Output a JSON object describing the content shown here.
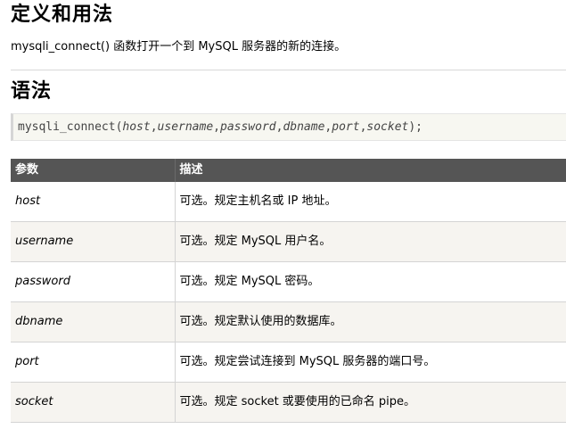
{
  "definition": {
    "heading": "定义和用法",
    "text": "mysqli_connect() 函数打开一个到 MySQL 服务器的新的连接。"
  },
  "syntax": {
    "heading": "语法",
    "code": {
      "func": "mysqli_connect(",
      "p1": "host",
      "p2": "username",
      "p3": "password",
      "p4": "dbname",
      "p5": "port",
      "p6": "socket",
      "sep": ",",
      "end": ");"
    }
  },
  "table": {
    "headers": [
      "参数",
      "描述"
    ],
    "rows": [
      {
        "param": "host",
        "desc": "可选。规定主机名或 IP 地址。"
      },
      {
        "param": "username",
        "desc": "可选。规定 MySQL 用户名。"
      },
      {
        "param": "password",
        "desc": "可选。规定 MySQL 密码。"
      },
      {
        "param": "dbname",
        "desc": "可选。规定默认使用的数据库。"
      },
      {
        "param": "port",
        "desc": "可选。规定尝试连接到 MySQL 服务器的端口号。"
      },
      {
        "param": "socket",
        "desc": "可选。规定 socket 或要使用的已命名 pipe。"
      }
    ]
  }
}
